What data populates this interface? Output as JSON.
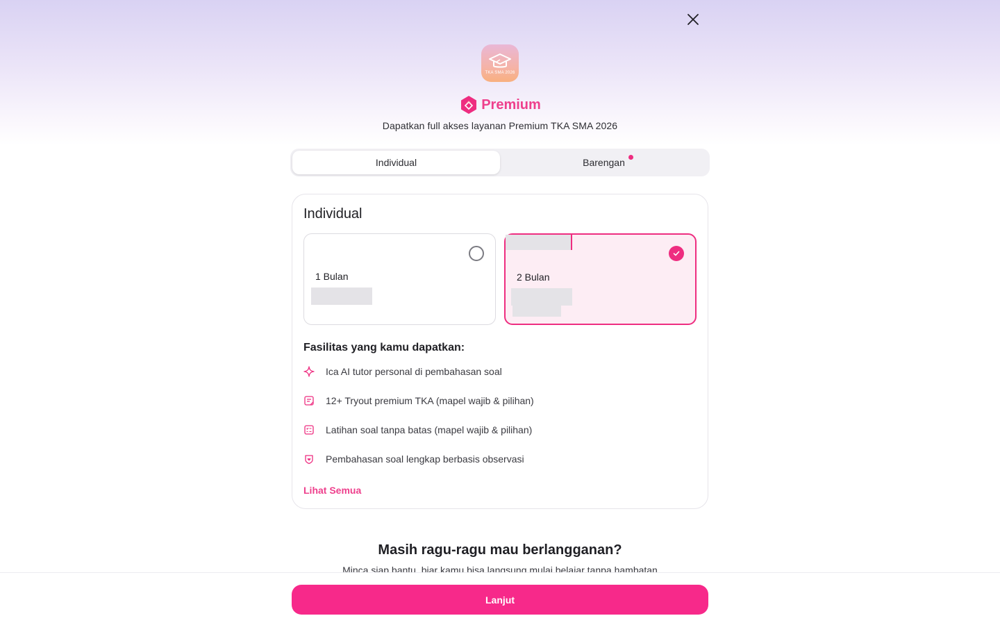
{
  "header": {
    "app_icon_text": "TKA SMA 2026",
    "premium_label": "Premium",
    "subtitle": "Dapatkan full akses layanan Premium TKA SMA 2026"
  },
  "tabs": [
    {
      "label": "Individual",
      "active": true
    },
    {
      "label": "Barengan",
      "active": false,
      "has_notification_dot": true
    }
  ],
  "card": {
    "title": "Individual",
    "plans": [
      {
        "label": "1 Bulan",
        "selected": false
      },
      {
        "label": "2 Bulan",
        "selected": true
      }
    ],
    "facilities_title": "Fasilitas yang kamu dapatkan:",
    "features": [
      {
        "icon": "sparkle-icon",
        "text": "Ica AI tutor personal di pembahasan soal"
      },
      {
        "icon": "note-icon",
        "text": "12+ Tryout premium TKA (mapel wajib & pilihan)"
      },
      {
        "icon": "checklist-icon",
        "text": "Latihan soal tanpa batas (mapel wajib & pilihan)"
      },
      {
        "icon": "shield-heart-icon",
        "text": "Pembahasan soal lengkap berbasis observasi"
      }
    ],
    "see_all": "Lihat Semua"
  },
  "hesitate": {
    "title": "Masih ragu-ragu mau berlangganan?",
    "subtitle": "Minca siap bantu, biar kamu bisa langsung mulai belajar tanpa hambatan"
  },
  "cta": {
    "label": "Lanjut"
  },
  "colors": {
    "accent": "#ee2d80",
    "cta": "#f7298a",
    "selected_plan_bg": "#fdedf4"
  }
}
